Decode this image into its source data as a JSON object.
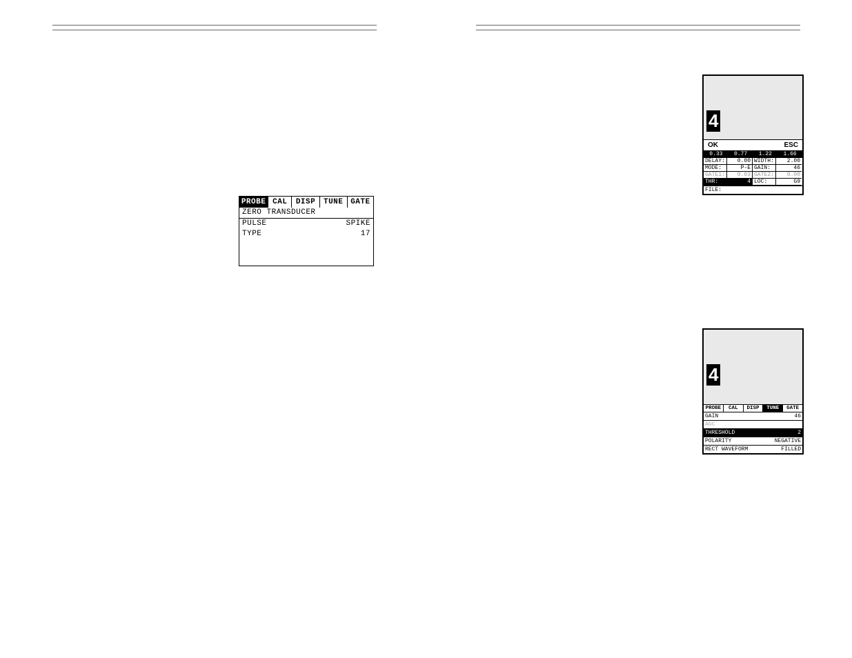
{
  "panelA": {
    "tabs": [
      "PROBE",
      "CAL",
      "DISP",
      "TUNE",
      "GATE"
    ],
    "selectedTab": 0,
    "rows": [
      {
        "label": "ZERO TRANSDUCER",
        "value": ""
      },
      {
        "label": "PULSE",
        "value": "SPIKE"
      },
      {
        "label": "TYPE",
        "value": "17"
      }
    ]
  },
  "panelB": {
    "bignum": "4",
    "ok": "OK",
    "esc": "ESC",
    "ruler": [
      "0.33",
      "0.77",
      "1.22",
      "1.66"
    ],
    "thrSelected": true,
    "hot": [
      {
        "k1": "DELAY:",
        "v1": "0.00",
        "k2": "WIDTH:",
        "v2": "2.00"
      },
      {
        "k1": "MODE:",
        "v1": "P-E",
        "k2": "GAIN:",
        "v2": "46"
      },
      {
        "k1": "GATE1:",
        "v1": "0.03",
        "k2": "GATE2:",
        "v2": "0.00",
        "dim": true
      },
      {
        "k1": "THR:",
        "v1": "4",
        "k2": "LOC:",
        "v2": "G9",
        "inv": "left"
      }
    ],
    "file": "FILE:"
  },
  "panelC": {
    "bignum": "4",
    "tabs": [
      "PROBE",
      "CAL",
      "DISP",
      "TUNE",
      "GATE"
    ],
    "selectedTab": 3,
    "rows": [
      {
        "label": "GAIN",
        "value": "46"
      },
      {
        "label": "AGC",
        "value": "",
        "dim": true
      },
      {
        "label": "THRESHOLD",
        "value": "2",
        "inv": true
      },
      {
        "label": "POLARITY",
        "value": "NEGATIVE"
      },
      {
        "label": "RECT WAVEFORM",
        "value": "FILLED"
      }
    ]
  }
}
